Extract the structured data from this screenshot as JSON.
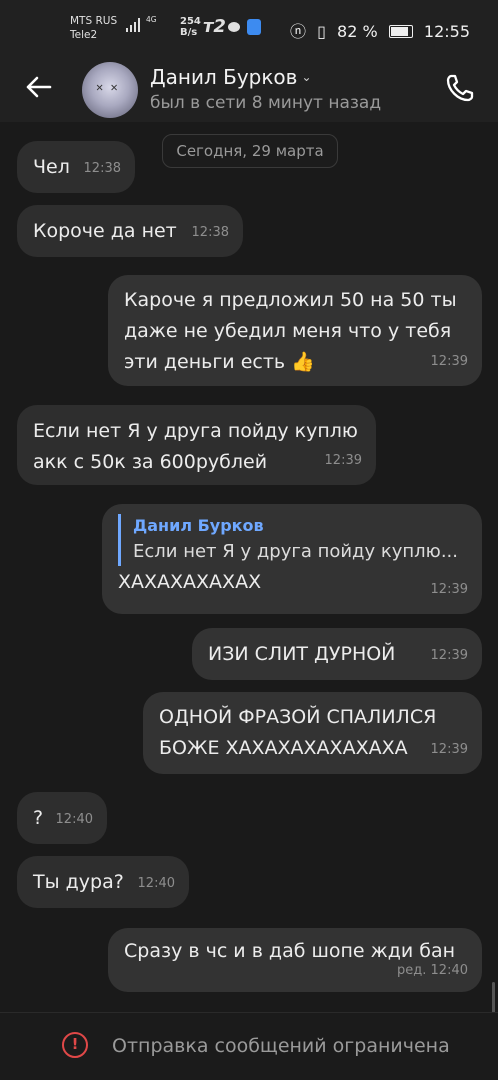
{
  "status_bar": {
    "carrier1": "MTS RUS",
    "carrier2": "Tele2",
    "net_type": "4G",
    "speed_value": "254",
    "speed_unit": "B/s",
    "t2_logo": "т2",
    "battery": "82 %",
    "time": "12:55",
    "icons": [
      "signal-icon",
      "chat-bubble-icon",
      "shield-app-icon",
      "nfc-icon",
      "vibrate-icon",
      "battery-icon"
    ]
  },
  "header": {
    "back_icon": "arrow-left-icon",
    "contact_name": "Данил Бурков",
    "status": "был в сети 8 минут назад",
    "call_icon": "phone-icon"
  },
  "date_divider": "Сегодня, 29 марта",
  "messages": [
    {
      "direction": "in",
      "text": "Чел",
      "time": "12:38"
    },
    {
      "direction": "in",
      "text": "Короче да нет",
      "time": "12:38"
    },
    {
      "direction": "out",
      "lines": [
        "Кароче я предложил 50 на 50 ты",
        "даже не убедил меня что у тебя",
        "эти деньги есть 👍"
      ],
      "time": "12:39"
    },
    {
      "direction": "in",
      "lines": [
        "Если нет Я у друга пойду куплю",
        "акк с 50к за 600рублей"
      ],
      "time": "12:39"
    },
    {
      "direction": "out",
      "reply_name": "Данил Бурков",
      "reply_text": "Если нет Я у друга пойду куплю...",
      "text": "ХАХАХАХАХАХ",
      "time": "12:39"
    },
    {
      "direction": "out",
      "text": "ИЗИ СЛИТ ДУРНОЙ",
      "time": "12:39"
    },
    {
      "direction": "out",
      "lines": [
        "ОДНОЙ ФРАЗОЙ СПАЛИЛСЯ",
        "БОЖЕ ХАХАХАХАХАХАХА"
      ],
      "time": "12:39"
    },
    {
      "direction": "in",
      "text": "?",
      "time": "12:40"
    },
    {
      "direction": "in",
      "text": "Ты дура?",
      "time": "12:40"
    },
    {
      "direction": "out",
      "text": "Сразу в чс и в даб шопе жди бан",
      "time": "ред. 12:40"
    }
  ],
  "footer": {
    "icon": "warning-circle-icon",
    "text": "Отправка сообщений ограничена"
  },
  "colors": {
    "background": "#1a1a1a",
    "bubble": "#2e2e2e",
    "reply_accent": "#6fa8ff",
    "warning": "#e04848"
  }
}
